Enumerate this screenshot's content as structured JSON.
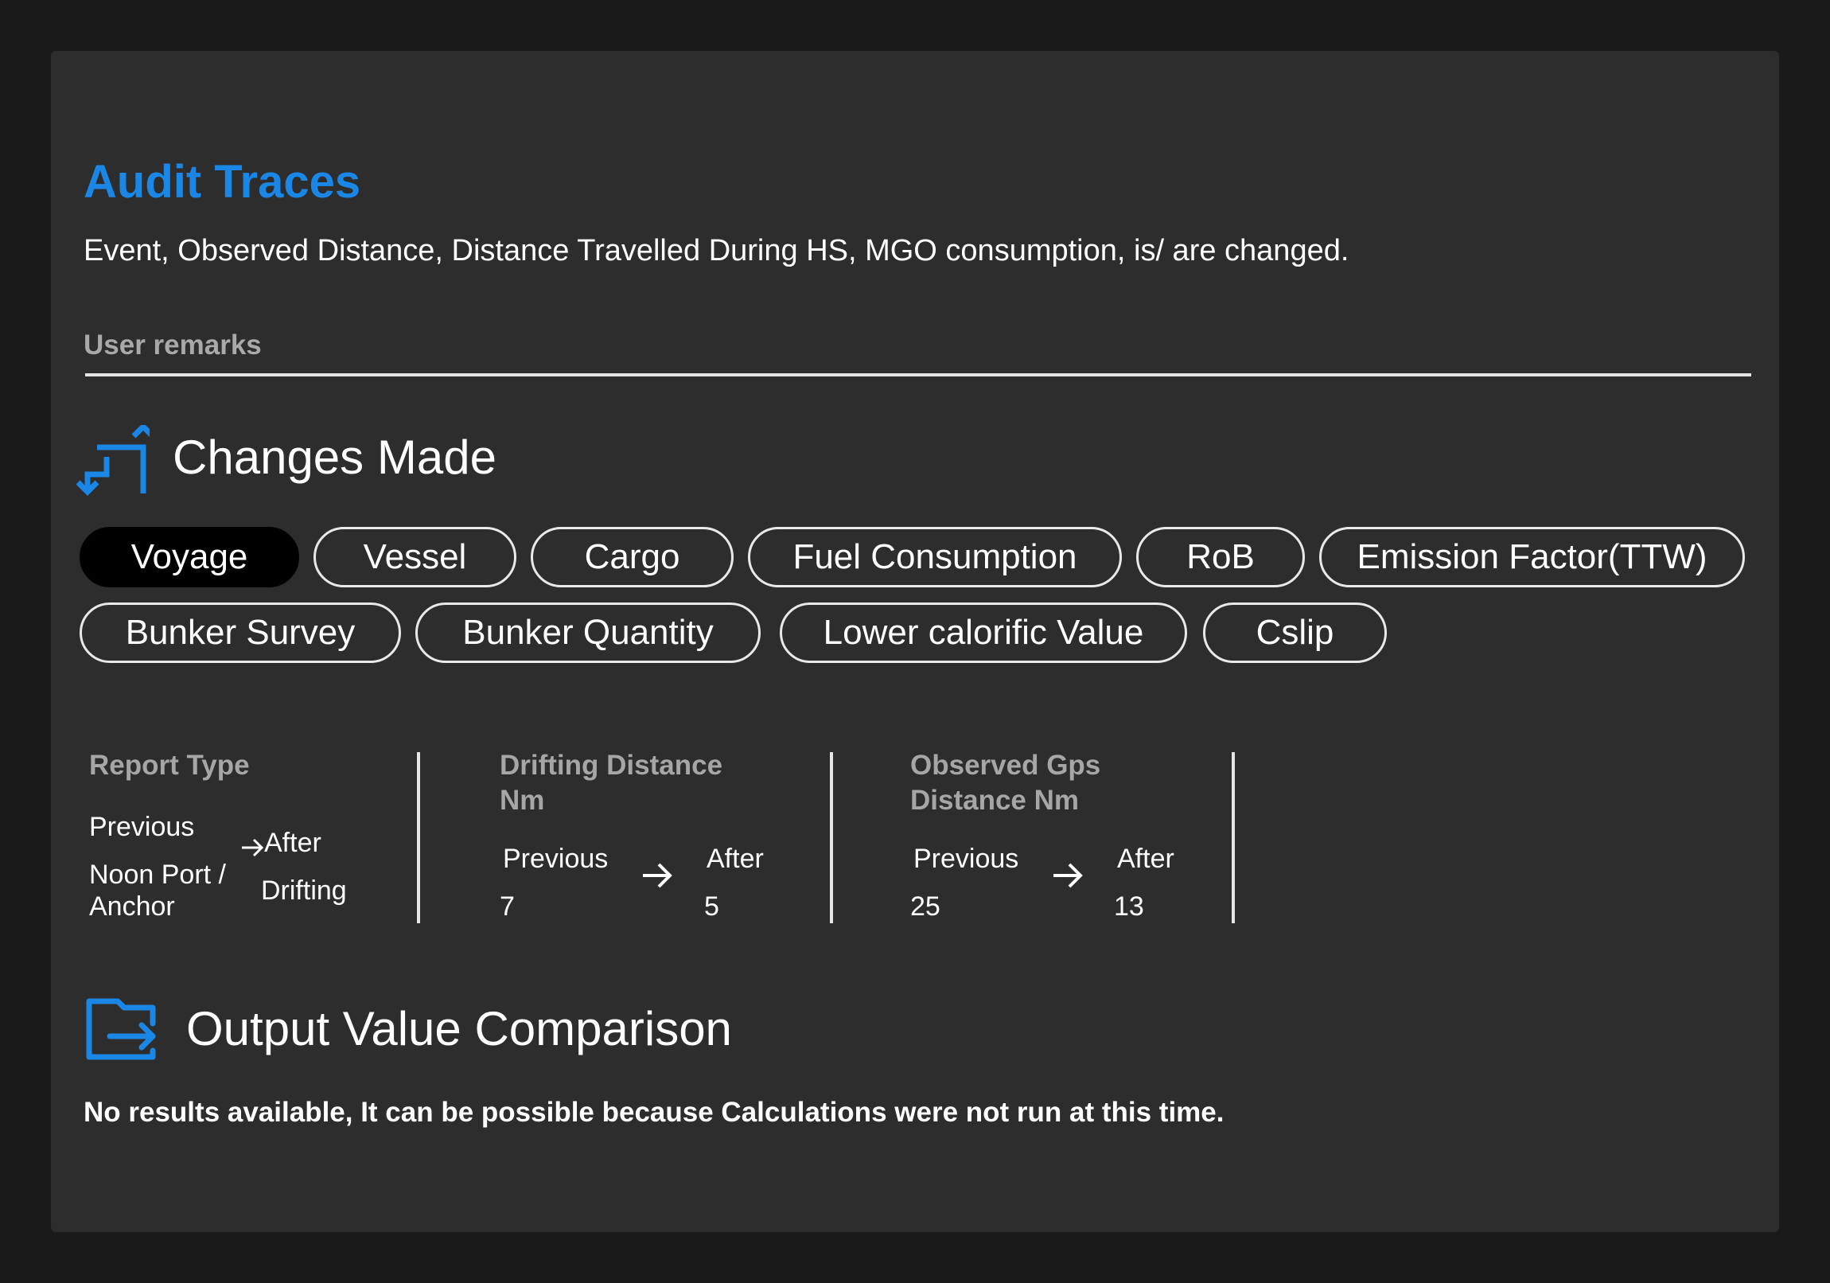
{
  "header": {
    "title": "Audit Traces",
    "summary": "Event, Observed Distance, Distance Travelled During HS, MGO consumption,  is/ are changed."
  },
  "remarks": {
    "label": "User remarks"
  },
  "changes": {
    "title": "Changes Made",
    "icon": "swap-vertical-arrows-icon",
    "tabs_row1": [
      {
        "label": "Voyage",
        "active": true
      },
      {
        "label": "Vessel"
      },
      {
        "label": "Cargo"
      },
      {
        "label": "Fuel Consumption"
      },
      {
        "label": "RoB"
      },
      {
        "label": "Emission Factor(TTW)"
      }
    ],
    "tabs_row2": [
      {
        "label": "Bunker Survey"
      },
      {
        "label": "Bunker Quantity"
      },
      {
        "label": "Lower calorific Value"
      },
      {
        "label": "Cslip"
      }
    ],
    "fields": [
      {
        "name_line1": "Report Type",
        "previous_label": "Previous",
        "after_label": "After",
        "previous_value_line1": "Noon Port /",
        "previous_value_line2": "Anchor",
        "after_value": "Drifting"
      },
      {
        "name_line1": "Drifting Distance",
        "name_line2": "Nm",
        "previous_label": "Previous",
        "after_label": "After",
        "previous_value": "7",
        "after_value": "5"
      },
      {
        "name_line1": "Observed Gps",
        "name_line2": "Distance Nm",
        "previous_label": "Previous",
        "after_label": "After",
        "previous_value": "25",
        "after_value": "13"
      }
    ]
  },
  "output": {
    "title": "Output Value Comparison",
    "icon": "folder-export-icon",
    "message": "No results available, It can be possible because Calculations were not run at this time."
  },
  "colors": {
    "accent": "#1a86e6",
    "panel": "#2d2d2d",
    "page": "#1a1a1a"
  }
}
